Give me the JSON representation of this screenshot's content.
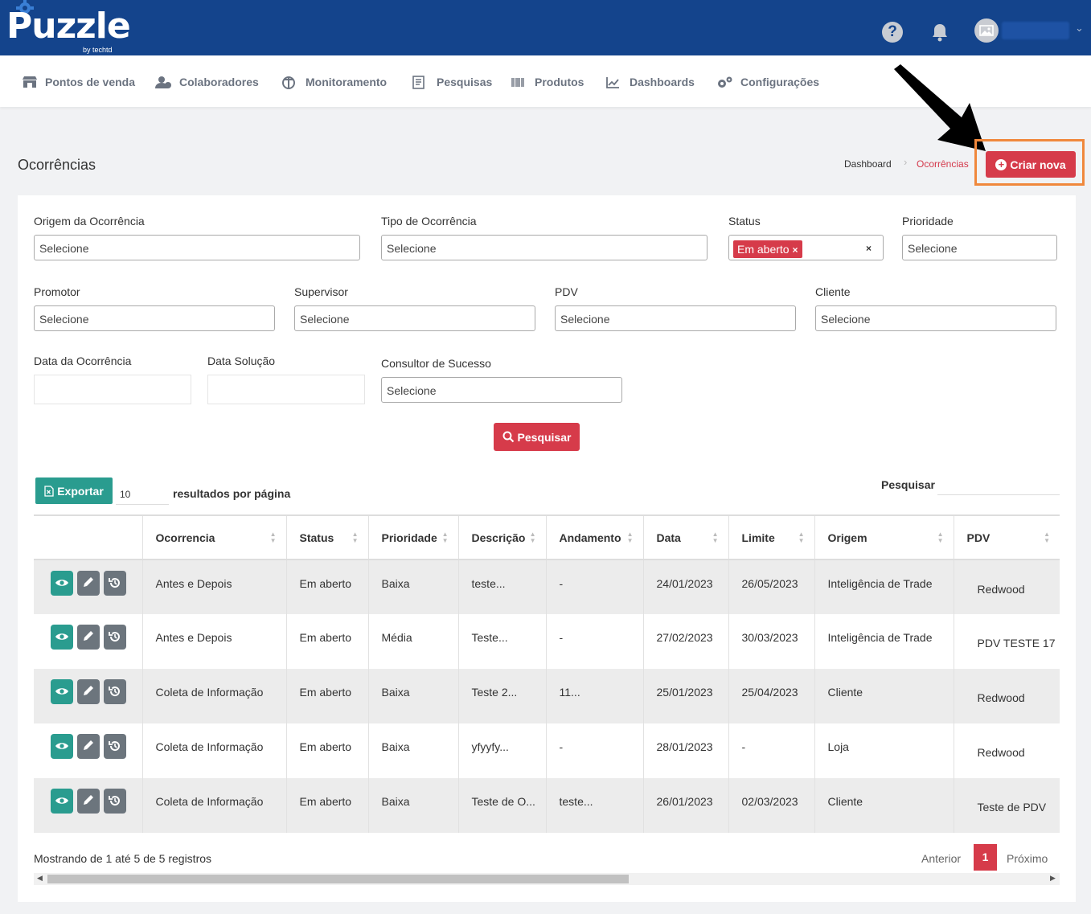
{
  "brand": {
    "name": "Puzzle",
    "sub": "by techtd"
  },
  "nav": [
    {
      "label": "Pontos de venda"
    },
    {
      "label": "Colaboradores"
    },
    {
      "label": "Monitoramento"
    },
    {
      "label": "Pesquisas"
    },
    {
      "label": "Produtos"
    },
    {
      "label": "Dashboards"
    },
    {
      "label": "Configurações"
    }
  ],
  "page": {
    "title": "Ocorrências",
    "breadcrumb": [
      "Dashboard",
      "Ocorrências"
    ],
    "create_button": "Criar nova"
  },
  "filters": {
    "origem": {
      "label": "Origem da Ocorrência",
      "value": "Selecione"
    },
    "tipo": {
      "label": "Tipo de Ocorrência",
      "value": "Selecione"
    },
    "status": {
      "label": "Status",
      "tag": "Em aberto",
      "tag_remove": "×",
      "clear": "×"
    },
    "prioridade": {
      "label": "Prioridade",
      "value": "Selecione"
    },
    "promotor": {
      "label": "Promotor",
      "value": "Selecione"
    },
    "supervisor": {
      "label": "Supervisor",
      "value": "Selecione"
    },
    "pdv": {
      "label": "PDV",
      "value": "Selecione"
    },
    "cliente": {
      "label": "Cliente",
      "value": "Selecione"
    },
    "data_ocorrencia": {
      "label": "Data da Ocorrência",
      "value": ""
    },
    "data_solucao": {
      "label": "Data Solução",
      "value": ""
    },
    "consultor": {
      "label": "Consultor de Sucesso",
      "value": "Selecione"
    },
    "search_button": "Pesquisar"
  },
  "table_controls": {
    "export": "Exportar",
    "page_length": "10",
    "page_length_label": "resultados por página",
    "search_label": "Pesquisar"
  },
  "table": {
    "columns": [
      "",
      "Ocorrencia",
      "Status",
      "Prioridade",
      "Descrição",
      "Andamento",
      "Data",
      "Limite",
      "Origem",
      "PDV"
    ],
    "rows": [
      [
        "Antes e Depois",
        "Em aberto",
        "Baixa",
        "teste...",
        "-",
        "24/01/2023",
        "26/05/2023",
        "Inteligência de Trade",
        "Redwood"
      ],
      [
        "Antes e Depois",
        "Em aberto",
        "Média",
        "Teste...",
        "-",
        "27/02/2023",
        "30/03/2023",
        "Inteligência de Trade",
        "PDV TESTE 17"
      ],
      [
        "Coleta de Informação",
        "Em aberto",
        "Baixa",
        "Teste 2...",
        "11...",
        "25/01/2023",
        "25/04/2023",
        "Cliente",
        "Redwood"
      ],
      [
        "Coleta de Informação",
        "Em aberto",
        "Baixa",
        "yfyyfy...",
        "-",
        "28/01/2023",
        "-",
        "Loja",
        "Redwood"
      ],
      [
        "Coleta de Informação",
        "Em aberto",
        "Baixa",
        "Teste de O...",
        "teste...",
        "26/01/2023",
        "02/03/2023",
        "Cliente",
        "Teste de PDV"
      ]
    ]
  },
  "pagination": {
    "info": "Mostrando de 1 até 5 de 5 registros",
    "prev": "Anterior",
    "current": "1",
    "next": "Próximo"
  },
  "colors": {
    "primary": "#14448c",
    "accent": "#d63b4a",
    "teal": "#2a9c8f",
    "highlight": "#f0883c"
  }
}
